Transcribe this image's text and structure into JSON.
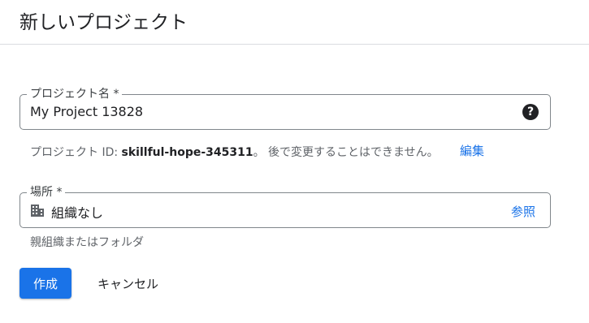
{
  "header": {
    "title": "新しいプロジェクト"
  },
  "project_name": {
    "label": "プロジェクト名 *",
    "value": "My Project 13828",
    "help_icon": "help-circle-icon"
  },
  "project_id": {
    "prefix": "プロジェクト ID: ",
    "id": "skillful-hope-345311",
    "suffix": "。 後で変更することはできません。",
    "edit_label": "編集"
  },
  "location": {
    "label": "場所 *",
    "value": "組織なし",
    "icon": "building-icon",
    "browse_label": "参照",
    "hint": "親組織またはフォルダ"
  },
  "actions": {
    "create_label": "作成",
    "cancel_label": "キャンセル"
  },
  "colors": {
    "accent": "#1a73e8",
    "border": "#80868b",
    "divider": "#dadce0"
  }
}
